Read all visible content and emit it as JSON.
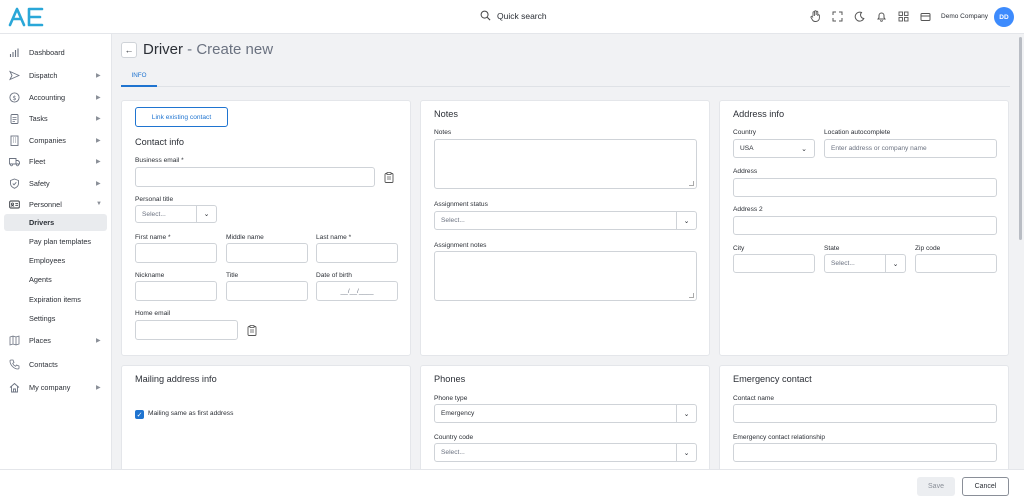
{
  "topbar": {
    "logo_text": "AE",
    "search_label": "Quick search",
    "company": "Demo Company",
    "avatar": "DD"
  },
  "sidebar": {
    "items": [
      {
        "label": "Dashboard",
        "icon": "chart-icon",
        "chevron": false
      },
      {
        "label": "Dispatch",
        "icon": "send-icon",
        "chevron": true
      },
      {
        "label": "Accounting",
        "icon": "dollar-icon",
        "chevron": true
      },
      {
        "label": "Tasks",
        "icon": "clipboard-icon",
        "chevron": true
      },
      {
        "label": "Companies",
        "icon": "building-icon",
        "chevron": true
      },
      {
        "label": "Fleet",
        "icon": "truck-icon",
        "chevron": true
      },
      {
        "label": "Safety",
        "icon": "shield-icon",
        "chevron": true
      },
      {
        "label": "Personnel",
        "icon": "id-card-icon",
        "chevron": true,
        "expanded": true
      }
    ],
    "personnel_sub": [
      {
        "label": "Drivers",
        "active": true
      },
      {
        "label": "Pay plan templates"
      },
      {
        "label": "Employees"
      },
      {
        "label": "Agents"
      },
      {
        "label": "Expiration items"
      },
      {
        "label": "Settings"
      }
    ],
    "items_after": [
      {
        "label": "Places",
        "icon": "map-icon",
        "chevron": true
      },
      {
        "label": "Contacts",
        "icon": "phone-icon",
        "chevron": false
      },
      {
        "label": "My company",
        "icon": "home-icon",
        "chevron": true
      }
    ]
  },
  "page": {
    "title": "Driver",
    "title_suffix": " - Create new",
    "tab": "INFO"
  },
  "contact": {
    "link_button": "Link existing contact",
    "title": "Contact info",
    "business_email_label": "Business email *",
    "personal_title_label": "Personal title",
    "personal_title_placeholder": "Select...",
    "first_name_label": "First name *",
    "middle_name_label": "Middle name",
    "last_name_label": "Last name *",
    "nickname_label": "Nickname",
    "title_label": "Title",
    "dob_label": "Date of birth",
    "dob_placeholder": "__/__/____",
    "home_email_label": "Home email"
  },
  "notes": {
    "title": "Notes",
    "notes_label": "Notes",
    "assignment_status_label": "Assignment status",
    "assignment_status_placeholder": "Select...",
    "assignment_notes_label": "Assignment notes"
  },
  "address": {
    "title": "Address info",
    "country_label": "Country",
    "country_value": "USA",
    "location_label": "Location autocomplete",
    "location_placeholder": "Enter address or company name",
    "address_label": "Address",
    "address2_label": "Address 2",
    "city_label": "City",
    "state_label": "State",
    "state_placeholder": "Select...",
    "zip_label": "Zip code"
  },
  "mailing": {
    "title": "Mailing address info",
    "same_label": "Mailing same as first address",
    "same_checked": true
  },
  "phones": {
    "title": "Phones",
    "phone_type_label": "Phone type",
    "phone_type_value": "Emergency",
    "country_code_label": "Country code",
    "country_code_placeholder": "Select..."
  },
  "emergency": {
    "title": "Emergency contact",
    "name_label": "Contact name",
    "relationship_label": "Emergency contact relationship"
  },
  "footer": {
    "save": "Save",
    "cancel": "Cancel"
  },
  "colors": {
    "accent": "#1f74d0",
    "avatar_bg": "#3d8bfd",
    "page_bg": "#f1f2f4"
  }
}
